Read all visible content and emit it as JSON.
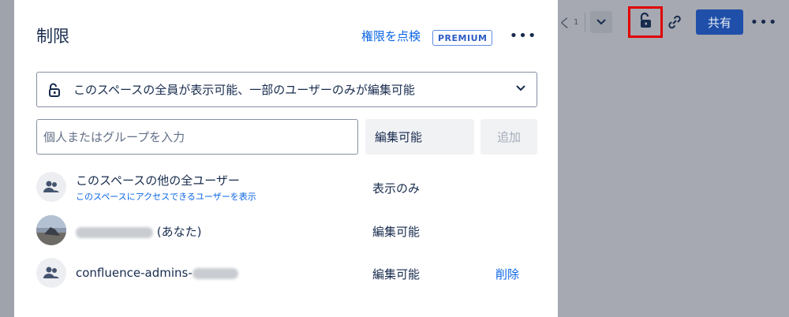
{
  "toolbar": {
    "partial_label_char": "く",
    "partial_label_num": "1",
    "share_label": "共有",
    "more_label": "•••"
  },
  "modal": {
    "title": "制限",
    "check_permissions": "権限を点検",
    "premium_badge": "PREMIUM",
    "more_label": "•••",
    "restriction": {
      "selected": "このスペースの全員が表示可能、一部のユーザーのみが編集可能",
      "icon": "unlock-icon"
    },
    "input": {
      "placeholder": "個人またはグループを入力",
      "value": ""
    },
    "permission_select": "編集可能",
    "add_button": "追加",
    "rows": [
      {
        "name": "このスペースの他の全ユーザー",
        "sub": "このスペースにアクセスできるユーザーを表示",
        "permission": "表示のみ",
        "icon": "group-icon"
      },
      {
        "name_suffix": "(あなた)",
        "permission": "編集可能",
        "icon": "user-photo"
      },
      {
        "name": "confluence-admins-",
        "permission": "編集可能",
        "remove": "削除",
        "icon": "group-icon"
      }
    ]
  }
}
